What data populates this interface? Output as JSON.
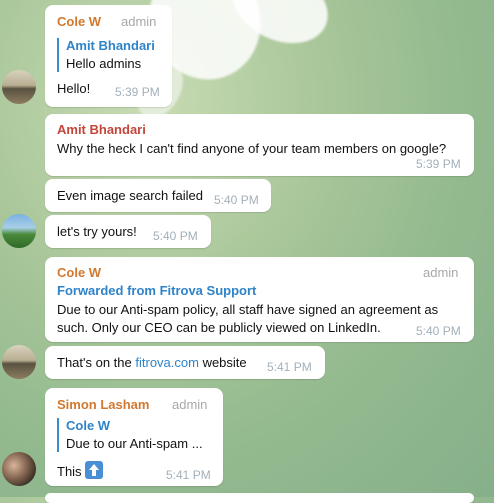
{
  "messages": [
    {
      "sender": "Cole W",
      "role": "admin",
      "reply_to": {
        "name": "Amit Bhandari",
        "text": "Hello admins"
      },
      "text": "Hello!",
      "time": "5:39 PM"
    },
    {
      "sender": "Amit Bhandari",
      "text": "Why the heck I can't find anyone of your team members on google?",
      "time": "5:39 PM"
    },
    {
      "text": "Even image search failed",
      "time": "5:40 PM"
    },
    {
      "text": "let's try yours!",
      "time": "5:40 PM"
    },
    {
      "sender": "Cole W",
      "role": "admin",
      "forwarded": "Forwarded from Fitrova Support",
      "text_line1": "Due to our Anti-spam policy, all staff have signed an agreement as",
      "text_line2": "such. Only our CEO can be publicly viewed on LinkedIn.",
      "time": "5:40 PM"
    },
    {
      "text_before": "That's on the ",
      "link": "fitrova.com",
      "text_after": " website",
      "time": "5:41 PM"
    },
    {
      "sender": "Simon Lasham",
      "role": "admin",
      "reply_to": {
        "name": "Cole W",
        "text": "Due to our Anti-spam ..."
      },
      "text": "This",
      "time": "5:41 PM"
    }
  ],
  "colors": {
    "cole": "#d2782f",
    "amit": "#c4453a",
    "simon": "#d2782f",
    "accent": "#2f83c9"
  },
  "icons": {
    "arrow": "up-arrow-emoji-icon"
  }
}
